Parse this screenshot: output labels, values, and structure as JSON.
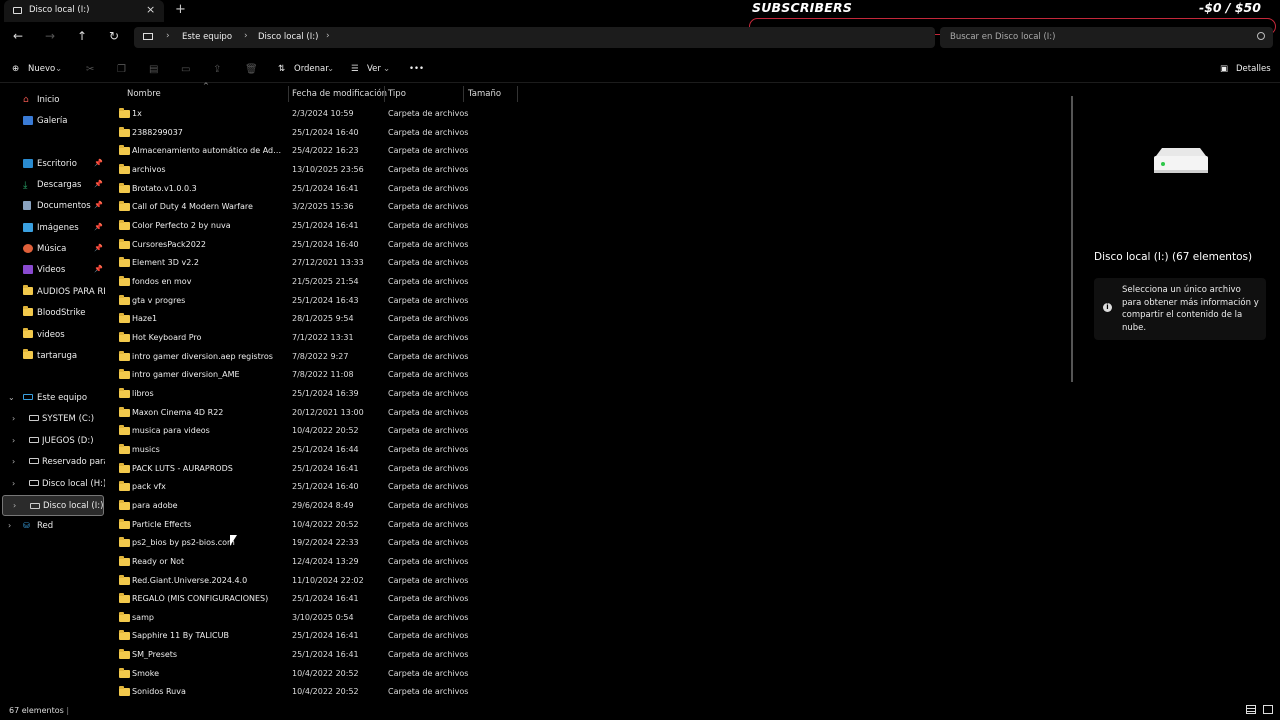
{
  "window": {
    "tab_title": "Disco local (I:)",
    "close_tab": "×",
    "new_tab": "+"
  },
  "overlay": {
    "title": "SUBSCRIBERS",
    "amount": "-$0 / $50"
  },
  "nav": {
    "crumbs": [
      "Este equipo",
      "Disco local (I:)"
    ],
    "search_placeholder": "Buscar en Disco local (I:)"
  },
  "toolbar": {
    "new_label": "Nuevo",
    "sort_label": "Ordenar",
    "view_label": "Ver",
    "more_label": "•••",
    "details_label": "Detalles"
  },
  "sidebar": {
    "items": [
      {
        "label": "Inicio",
        "icon": "home-icon",
        "pinned": false
      },
      {
        "label": "Galería",
        "icon": "gallery-icon",
        "pinned": false
      },
      {
        "label": "Escritorio",
        "icon": "desktop-icon",
        "pinned": true
      },
      {
        "label": "Descargas",
        "icon": "downloads-icon",
        "pinned": true
      },
      {
        "label": "Documentos",
        "icon": "documents-icon",
        "pinned": true
      },
      {
        "label": "Imágenes",
        "icon": "pictures-icon",
        "pinned": true
      },
      {
        "label": "Música",
        "icon": "music-icon",
        "pinned": true
      },
      {
        "label": "Videos",
        "icon": "videos-icon",
        "pinned": true
      },
      {
        "label": "AUDIOS PARA RECI",
        "icon": "folder-icon",
        "pinned": false
      },
      {
        "label": "BloodStrike",
        "icon": "folder-icon",
        "pinned": false
      },
      {
        "label": "videos",
        "icon": "folder-icon",
        "pinned": false
      },
      {
        "label": "tartaruga",
        "icon": "folder-icon",
        "pinned": false
      }
    ],
    "tree": [
      {
        "label": "Este equipo",
        "icon": "pc-icon"
      },
      {
        "label": "SYSTEM (C:)",
        "icon": "drive-icon"
      },
      {
        "label": "JUEGOS (D:)",
        "icon": "drive-icon"
      },
      {
        "label": "Reservado para el",
        "icon": "drive-icon"
      },
      {
        "label": "Disco local (H:)",
        "icon": "drive-icon"
      },
      {
        "label": "Disco local (I:)",
        "icon": "drive-icon"
      },
      {
        "label": "Red",
        "icon": "network-icon"
      }
    ]
  },
  "columns": {
    "name": "Nombre",
    "modified": "Fecha de modificación",
    "type": "Tipo",
    "size": "Tamaño"
  },
  "files": [
    {
      "name": "1x",
      "date": "2/3/2024 10:59",
      "type": "Carpeta de archivos"
    },
    {
      "name": "2388299037",
      "date": "25/1/2024 16:40",
      "type": "Carpeta de archivos"
    },
    {
      "name": "Almacenamiento automático de Adobe ...",
      "date": "25/4/2022 16:23",
      "type": "Carpeta de archivos"
    },
    {
      "name": "archivos",
      "date": "13/10/2025 23:56",
      "type": "Carpeta de archivos"
    },
    {
      "name": "Brotato.v1.0.0.3",
      "date": "25/1/2024 16:41",
      "type": "Carpeta de archivos"
    },
    {
      "name": "Call of Duty 4 Modern Warfare",
      "date": "3/2/2025 15:36",
      "type": "Carpeta de archivos"
    },
    {
      "name": "Color Perfecto 2 by nuva",
      "date": "25/1/2024 16:41",
      "type": "Carpeta de archivos"
    },
    {
      "name": "CursoresPack2022",
      "date": "25/1/2024 16:40",
      "type": "Carpeta de archivos"
    },
    {
      "name": "Element 3D v2.2",
      "date": "27/12/2021 13:33",
      "type": "Carpeta de archivos"
    },
    {
      "name": "fondos en mov",
      "date": "21/5/2025 21:54",
      "type": "Carpeta de archivos"
    },
    {
      "name": "gta v progres",
      "date": "25/1/2024 16:43",
      "type": "Carpeta de archivos"
    },
    {
      "name": "Haze1",
      "date": "28/1/2025 9:54",
      "type": "Carpeta de archivos"
    },
    {
      "name": "Hot Keyboard Pro",
      "date": "7/1/2022 13:31",
      "type": "Carpeta de archivos"
    },
    {
      "name": "intro gamer diversion.aep registros",
      "date": "7/8/2022 9:27",
      "type": "Carpeta de archivos"
    },
    {
      "name": "intro gamer diversion_AME",
      "date": "7/8/2022 11:08",
      "type": "Carpeta de archivos"
    },
    {
      "name": "libros",
      "date": "25/1/2024 16:39",
      "type": "Carpeta de archivos"
    },
    {
      "name": "Maxon Cinema 4D R22",
      "date": "20/12/2021 13:00",
      "type": "Carpeta de archivos"
    },
    {
      "name": "musica para videos",
      "date": "10/4/2022 20:52",
      "type": "Carpeta de archivos"
    },
    {
      "name": "musics",
      "date": "25/1/2024 16:44",
      "type": "Carpeta de archivos"
    },
    {
      "name": "PACK LUTS - AURAPRODS",
      "date": "25/1/2024 16:41",
      "type": "Carpeta de archivos"
    },
    {
      "name": "pack vfx",
      "date": "25/1/2024 16:40",
      "type": "Carpeta de archivos"
    },
    {
      "name": "para adobe",
      "date": "29/6/2024 8:49",
      "type": "Carpeta de archivos"
    },
    {
      "name": "Particle Effects",
      "date": "10/4/2022 20:52",
      "type": "Carpeta de archivos"
    },
    {
      "name": "ps2_bios by ps2-bios.com",
      "date": "19/2/2024 22:33",
      "type": "Carpeta de archivos"
    },
    {
      "name": "Ready or Not",
      "date": "12/4/2024 13:29",
      "type": "Carpeta de archivos"
    },
    {
      "name": "Red.Giant.Universe.2024.4.0",
      "date": "11/10/2024 22:02",
      "type": "Carpeta de archivos"
    },
    {
      "name": "REGALÓ (MIS CONFIGURACIONES)",
      "date": "25/1/2024 16:41",
      "type": "Carpeta de archivos"
    },
    {
      "name": "samp",
      "date": "3/10/2025 0:54",
      "type": "Carpeta de archivos"
    },
    {
      "name": "Sapphire 11 By TALICUB",
      "date": "25/1/2024 16:41",
      "type": "Carpeta de archivos"
    },
    {
      "name": "SM_Presets",
      "date": "25/1/2024 16:41",
      "type": "Carpeta de archivos"
    },
    {
      "name": "Smoke",
      "date": "10/4/2022 20:52",
      "type": "Carpeta de archivos"
    },
    {
      "name": "Sonidos Ruva",
      "date": "10/4/2022 20:52",
      "type": "Carpeta de archivos"
    }
  ],
  "details": {
    "title": "Disco local (I:) (67 elementos)",
    "info": "Selecciona un único archivo para obtener más información y compartir el contenido de la nube."
  },
  "status": {
    "count": "67 elementos"
  }
}
